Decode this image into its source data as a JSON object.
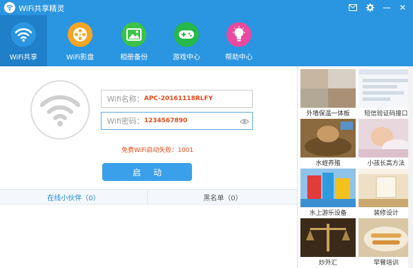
{
  "app": {
    "title": "WiFi共享精灵"
  },
  "window_controls": {
    "mail_icon": "mail-icon",
    "settings_icon": "gear-icon",
    "minimize_label": "—",
    "close_label": "✕"
  },
  "nav": {
    "items": [
      {
        "label": "WiFi共享",
        "icon": "wifi-icon",
        "color": "#2a95e0",
        "active": true
      },
      {
        "label": "WiFi影盘",
        "icon": "film-reel-icon",
        "color": "#f5a623"
      },
      {
        "label": "相册备份",
        "icon": "photo-icon",
        "color": "#3cc24a"
      },
      {
        "label": "游戏中心",
        "icon": "gamepad-icon",
        "color": "#27b84a"
      },
      {
        "label": "帮助中心",
        "icon": "lightbulb-icon",
        "color": "#e94aa0"
      }
    ]
  },
  "form": {
    "ssid_label": "Wifi名称：",
    "ssid_value": "APC-20161118RLFY",
    "password_label": "Wifi密码：",
    "password_value": "1234567890",
    "error_message": "免费WiFi启动失败：1001",
    "start_button": "启动"
  },
  "tabs": {
    "online": "在线小伙伴（0）",
    "blacklist": "黑名单（0）"
  },
  "ads": [
    {
      "caption": "外墙保温一体板"
    },
    {
      "caption": "短信验证码接口"
    },
    {
      "caption": "水蛭养殖"
    },
    {
      "caption": "小孩长高方法"
    },
    {
      "caption": "水上游乐设备"
    },
    {
      "caption": "装修设计"
    },
    {
      "caption": "炒外汇"
    },
    {
      "caption": "早餐培训"
    }
  ],
  "colors": {
    "brand_blue": "#2a95e0",
    "error_red": "#e04a1a"
  }
}
